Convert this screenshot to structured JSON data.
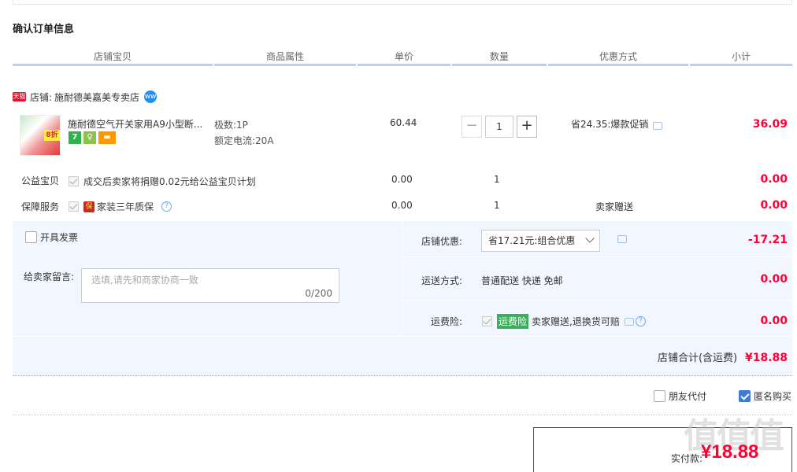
{
  "section_title": "确认订单信息",
  "table_headers": [
    "店铺宝贝",
    "商品属性",
    "单价",
    "数量",
    "优惠方式",
    "小计"
  ],
  "shop": {
    "label": "店铺:",
    "name": "施耐德美嘉美专卖店",
    "tmall_icon_text": "天猫",
    "chat_icon_text": "ww"
  },
  "product": {
    "title": "施耐德空气开关家用A9小型断...",
    "image_badge": "8折",
    "service_icons": [
      "7",
      "♀",
      "▬"
    ],
    "attr_1": "极数:1P",
    "attr_2": "额定电流:20A",
    "unit_price": "60.44",
    "quantity": "1",
    "qty_minus": "−",
    "qty_plus": "+",
    "promo": "省24.35:爆款促销",
    "subtotal": "36.09"
  },
  "charity": {
    "label": "公益宝贝",
    "text": "成交后卖家将捐赠0.02元给公益宝贝计划",
    "price": "0.00",
    "quantity": "1",
    "subtotal": "0.00"
  },
  "warranty": {
    "label": "保障服务",
    "icon_text": "保",
    "text": "家装三年质保",
    "price": "0.00",
    "quantity": "1",
    "promo": "卖家赠送",
    "subtotal": "0.00"
  },
  "invoice": {
    "label": "开具发票"
  },
  "message": {
    "label": "给卖家留言:",
    "placeholder": "选填,请先和商家协商一致",
    "counter": "0/200"
  },
  "shop_discount": {
    "label": "店铺优惠:",
    "selected": "省17.21元:组合优惠",
    "amount": "-17.21"
  },
  "shipping": {
    "label": "运送方式:",
    "text": "普通配送 快递 免邮",
    "amount": "0.00"
  },
  "shipping_insurance": {
    "label": "运费险:",
    "tag": "运费险",
    "text": "卖家赠送,退换货可赔",
    "amount": "0.00"
  },
  "shop_total": {
    "label": "店铺合计(含运费)",
    "amount": "¥18.88"
  },
  "options": {
    "friend_pay": "朋友代付",
    "anonymous": "匿名购买"
  },
  "payment": {
    "label": "实付款:",
    "amount": "¥18.88"
  },
  "watermark": "值值值",
  "colors": {
    "accent_red": "#ff0036",
    "header_underline": "#b2d1ff",
    "panel_bg": "#f2f7ff",
    "checkbox_blue": "#3d7bd8"
  }
}
